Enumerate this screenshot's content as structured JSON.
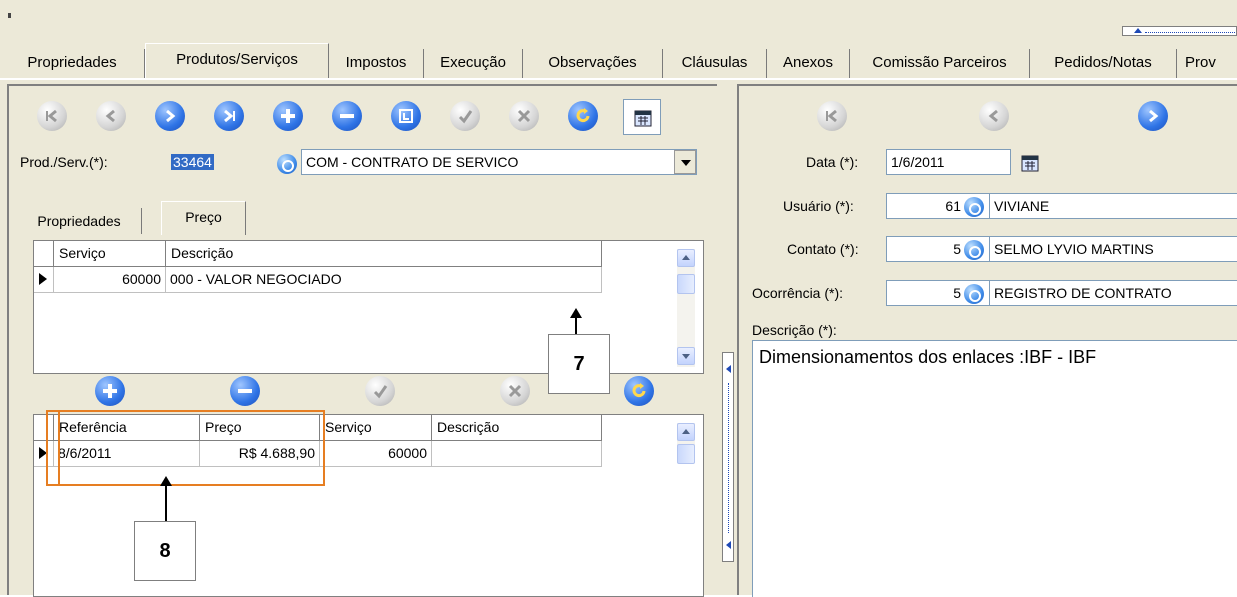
{
  "tabs": [
    "Propriedades",
    "Produtos/Serviços",
    "Impostos",
    "Execução",
    "Observações",
    "Cláusulas",
    "Anexos",
    "Comissão Parceiros",
    "Pedidos/Notas",
    "Prov"
  ],
  "left": {
    "toolbar_icons": [
      "first-icon",
      "prior-icon",
      "next-icon",
      "last-icon",
      "insert-icon",
      "delete-icon",
      "edit-icon",
      "post-icon",
      "cancel-icon",
      "refresh-icon",
      "calendar-icon"
    ],
    "prod_label": "Prod./Serv.(*):",
    "prod_code": "33464",
    "prod_desc": "COM - CONTRATO DE SERVICO",
    "subtabs": [
      "Propriedades",
      "Preço"
    ],
    "grid1": {
      "headers": [
        "Serviço",
        "Descrição"
      ],
      "row": {
        "servico": "60000",
        "descricao": "000 - VALOR NEGOCIADO"
      }
    },
    "grid2_toolbar": [
      "insert-icon",
      "delete-icon",
      "post-icon",
      "cancel-icon",
      "refresh-icon"
    ],
    "grid2": {
      "headers": [
        "Referência",
        "Preço",
        "Serviço",
        "Descrição"
      ],
      "row": {
        "referencia": "8/6/2011",
        "preco": "R$ 4.688,90",
        "servico": "60000",
        "descricao": ""
      }
    }
  },
  "right": {
    "toolbar_icons": [
      "first-icon",
      "prior-icon",
      "next-icon"
    ],
    "data_label": "Data (*):",
    "data_value": "1/6/2011",
    "usuario_label": "Usuário (*):",
    "usuario_code": "61",
    "usuario_name": "VIVIANE",
    "contato_label": "Contato (*):",
    "contato_code": "5",
    "contato_name": "SELMO LYVIO MARTINS",
    "ocorrencia_label": "Ocorrência (*):",
    "ocorrencia_code": "5",
    "ocorrencia_name": "REGISTRO DE CONTRATO",
    "descricao_label": "Descrição (*):",
    "descricao_text": "Dimensionamentos dos enlaces :IBF - IBF"
  },
  "callouts": {
    "seven": "7",
    "eight": "8"
  }
}
